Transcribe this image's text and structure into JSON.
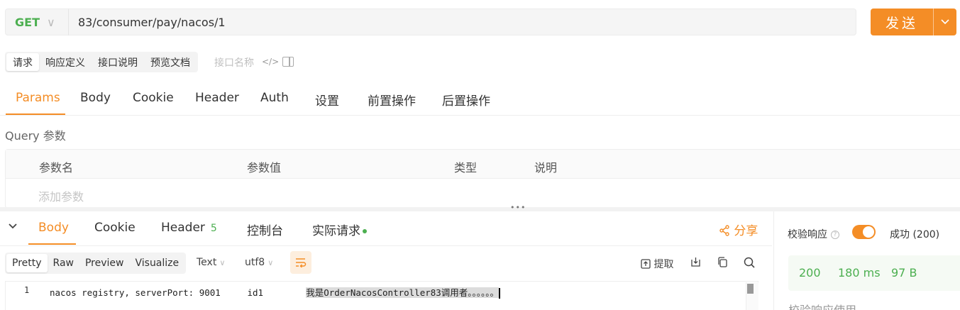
{
  "request": {
    "method": "GET",
    "url": "83/consumer/pay/nacos/1",
    "send_label": "发送"
  },
  "subtabs": [
    "请求",
    "响应定义",
    "接口说明",
    "预览文档"
  ],
  "api_name_placeholder": "接口名称",
  "req_tabs": [
    "Params",
    "Body",
    "Cookie",
    "Header",
    "Auth",
    "设置",
    "前置操作",
    "后置操作"
  ],
  "query_label": "Query 参数",
  "param_table": {
    "headers": [
      "参数名",
      "参数值",
      "类型",
      "说明"
    ],
    "add_label": "添加参数"
  },
  "response": {
    "tabs": [
      "Body",
      "Cookie",
      "Header",
      "控制台",
      "实际请求"
    ],
    "header_count": "5",
    "share_label": "分享",
    "formats": [
      "Pretty",
      "Raw",
      "Preview",
      "Visualize"
    ],
    "type_select": "Text",
    "encoding_select": "utf8",
    "extract_label": "提取",
    "line_number": "1",
    "code_plain": "nacos registry, serverPort: 9001     id1        ",
    "code_highlight": "我是OrderNacosController83调用者。。。。。。"
  },
  "side": {
    "verify_label": "校验响应",
    "result": "成功 (200)",
    "status": "200",
    "time": "180 ms",
    "size": "97 B",
    "cut_text": "校验响应使用"
  },
  "colors": {
    "accent": "#f48d26",
    "success": "#4caf50"
  }
}
